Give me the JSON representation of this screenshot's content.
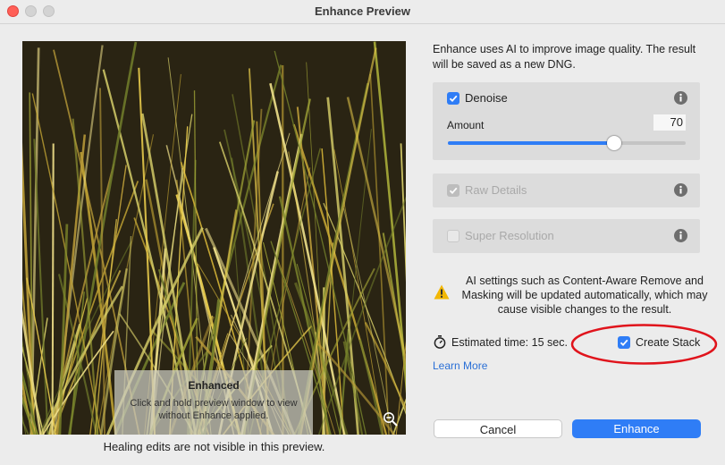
{
  "window": {
    "title": "Enhance Preview"
  },
  "preview": {
    "overlay_title": "Enhanced",
    "overlay_text": "Click and hold preview window to view without Enhance applied.",
    "zoom_icon": "zoom-out-icon",
    "note": "Healing edits are not visible in this preview."
  },
  "intro_text": "Enhance uses AI to improve image quality. The result will be saved as a new DNG.",
  "options": {
    "denoise": {
      "label": "Denoise",
      "checked": true,
      "enabled": true,
      "amount_label": "Amount",
      "amount_value": "70",
      "amount_max": 100
    },
    "raw_details": {
      "label": "Raw Details",
      "checked": true,
      "enabled": false
    },
    "super_resolution": {
      "label": "Super Resolution",
      "checked": false,
      "enabled": false
    },
    "info_icon": "info-icon"
  },
  "warning": {
    "icon": "warning-icon",
    "text": "AI settings such as Content-Aware Remove and Masking will be updated automatically, which may cause visible changes to the result."
  },
  "estimate": {
    "icon": "stopwatch-icon",
    "text": "Estimated time: 15 sec."
  },
  "create_stack": {
    "label": "Create Stack",
    "checked": true
  },
  "learn_more": "Learn More",
  "buttons": {
    "cancel": "Cancel",
    "enhance": "Enhance"
  },
  "colors": {
    "accent": "#2f7df6",
    "annotation": "#e0141c",
    "warning": "#f2b705",
    "link": "#2a6fd6"
  }
}
